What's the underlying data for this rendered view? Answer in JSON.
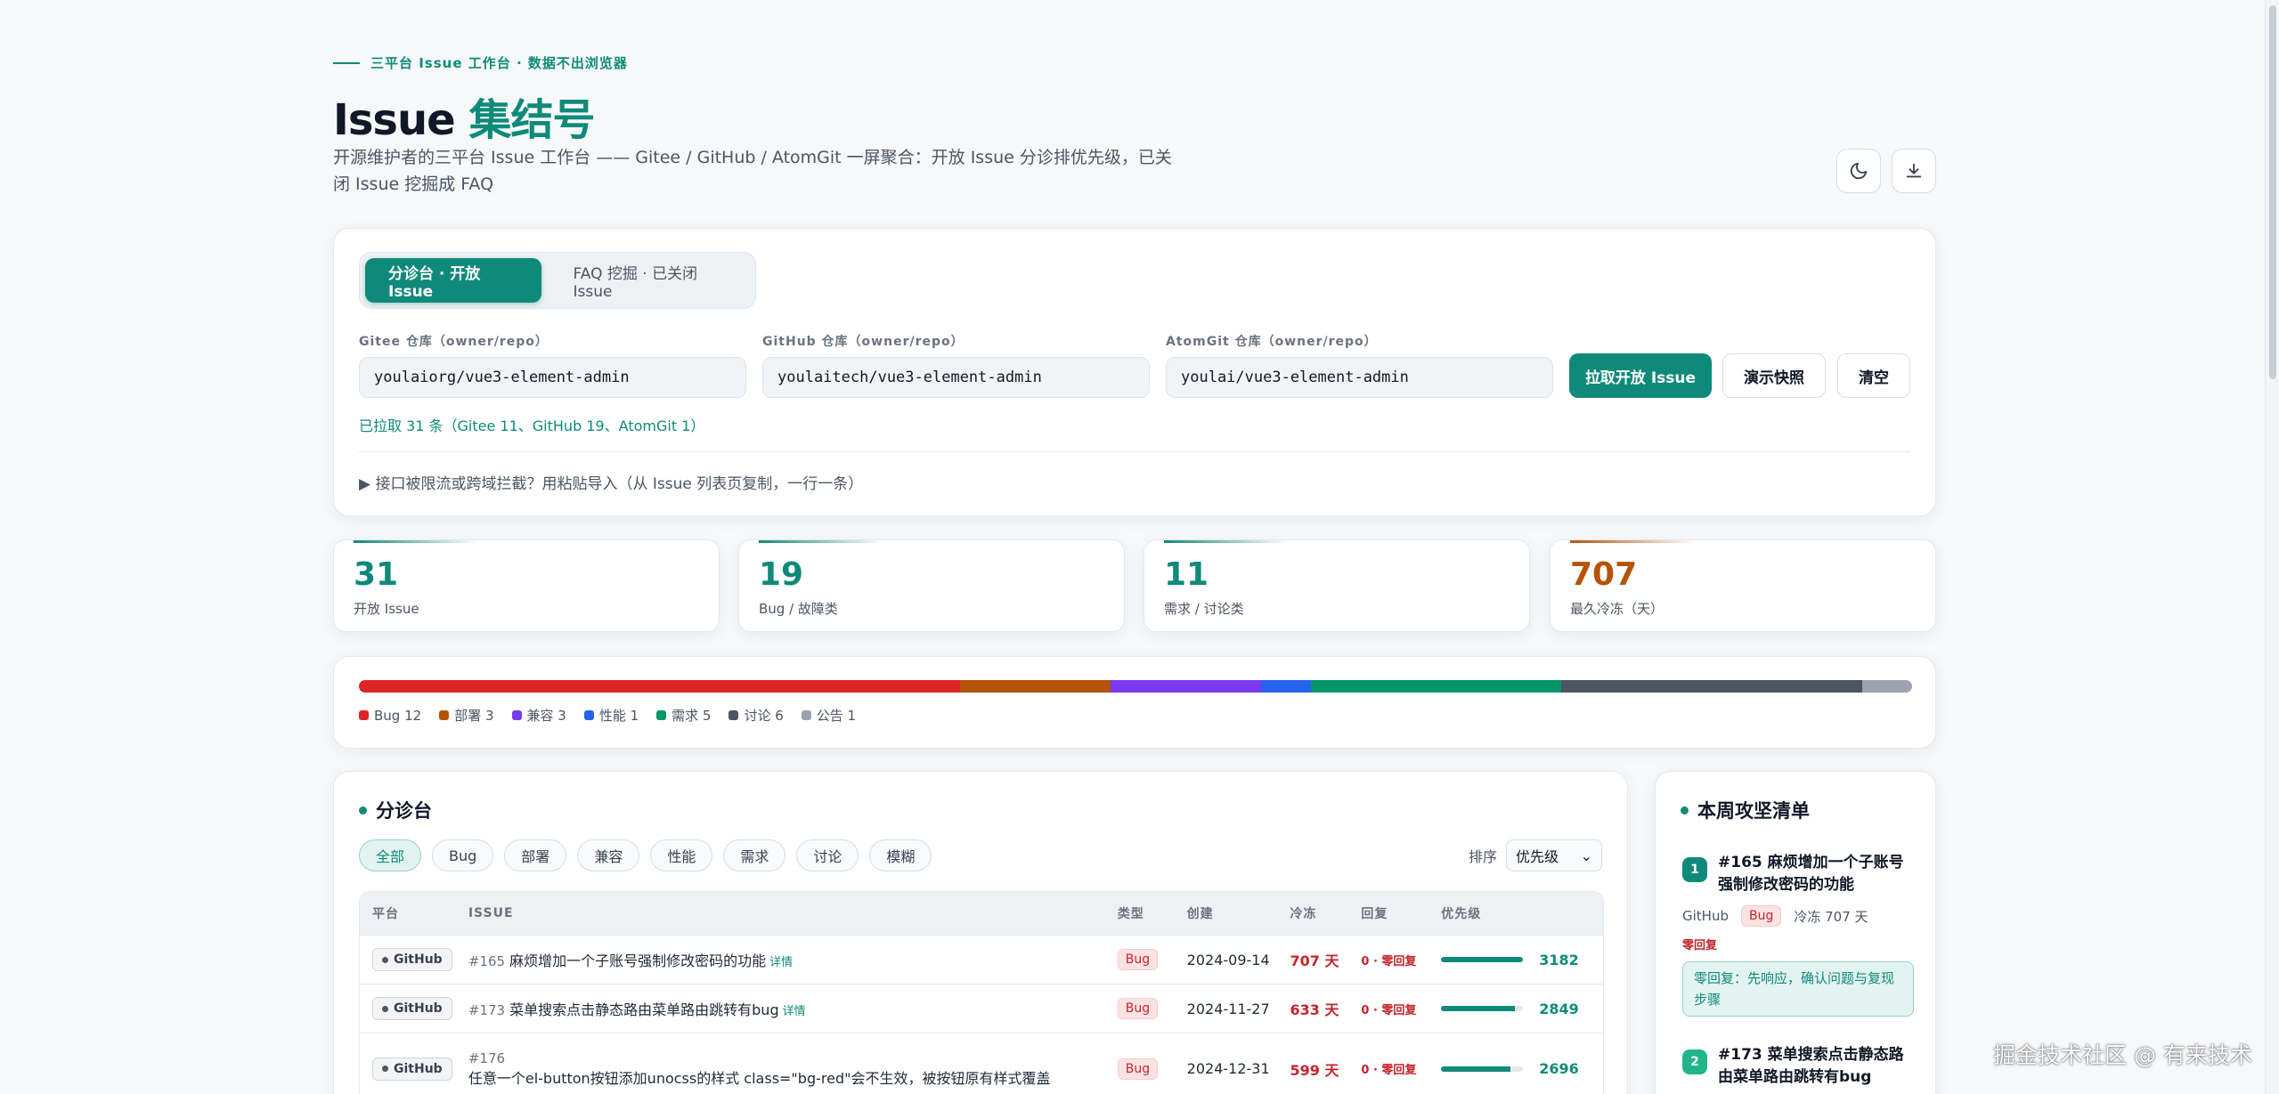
{
  "header": {
    "tagline": "三平台 Issue 工作台 · 数据不出浏览器",
    "title_main": "Issue ",
    "title_accent": "集结号",
    "subtitle": "开源维护者的三平台 Issue 工作台 —— Gitee / GitHub / AtomGit 一屏聚合：开放 Issue 分诊排优先级，已关闭 Issue 挖掘成 FAQ",
    "theme_icon": "moon-icon",
    "download_icon": "download-icon"
  },
  "panel": {
    "modes": [
      "分诊台 · 开放 Issue",
      "FAQ 挖掘 · 已关闭 Issue"
    ],
    "active_mode": 0,
    "fields": [
      {
        "label": "Gitee 仓库（owner/repo）",
        "value": "youlaiorg/vue3-element-admin"
      },
      {
        "label": "GitHub 仓库（owner/repo）",
        "value": "youlaitech/vue3-element-admin"
      },
      {
        "label": "AtomGit 仓库（owner/repo）",
        "value": "youlai/vue3-element-admin"
      }
    ],
    "buttons": {
      "fetch": "拉取开放 Issue",
      "demo": "演示快照",
      "clear": "清空"
    },
    "status": "已拉取 31 条（Gitee 11、GitHub 19、AtomGit 1）",
    "paste_toggle": "▶ 接口被限流或跨域拦截？用粘贴导入（从 Issue 列表页复制，一行一条）"
  },
  "stats": [
    {
      "value": "31",
      "label": "开放 Issue",
      "color": "#0f8a7a"
    },
    {
      "value": "19",
      "label": "Bug / 故障类",
      "color": "#0f8a7a"
    },
    {
      "value": "11",
      "label": "需求 / 讨论类",
      "color": "#0f8a7a"
    },
    {
      "value": "707",
      "label": "最久冷冻（天）",
      "color": "#b45309"
    }
  ],
  "distribution": [
    {
      "label": "Bug 12",
      "count": 12,
      "color": "#dc2626"
    },
    {
      "label": "部署 3",
      "count": 3,
      "color": "#b45309"
    },
    {
      "label": "兼容 3",
      "count": 3,
      "color": "#7c3aed"
    },
    {
      "label": "性能 1",
      "count": 1,
      "color": "#2563eb"
    },
    {
      "label": "需求 5",
      "count": 5,
      "color": "#059669"
    },
    {
      "label": "讨论 6",
      "count": 6,
      "color": "#4b5563"
    },
    {
      "label": "公告 1",
      "count": 1,
      "color": "#9ca3af"
    }
  ],
  "triage": {
    "title": "分诊台",
    "filters": [
      "全部",
      "Bug",
      "部署",
      "兼容",
      "性能",
      "需求",
      "讨论",
      "模糊"
    ],
    "active_filter": 0,
    "sort_label": "排序",
    "sort_value": "优先级",
    "columns": [
      "平台",
      "ISSUE",
      "类型",
      "创建",
      "冷冻",
      "回复",
      "优先级"
    ],
    "rows": [
      {
        "platform": "GitHub",
        "num": "#165",
        "title": "麻烦增加一个子账号强制修改密码的功能",
        "detail": "详情",
        "type": "Bug",
        "created": "2024-09-14",
        "frozen": "707 天",
        "reply": "0 · 零回复",
        "priority": 3182,
        "priority_pct": 1.0
      },
      {
        "platform": "GitHub",
        "num": "#173",
        "title": "菜单搜索点击静态路由菜单路由跳转有bug",
        "detail": "详情",
        "type": "Bug",
        "created": "2024-11-27",
        "frozen": "633 天",
        "reply": "0 · 零回复",
        "priority": 2849,
        "priority_pct": 0.9
      },
      {
        "platform": "GitHub",
        "num": "#176",
        "title": "任意一个el-button按钮添加unocss的样式 class=\"bg-red\"会不生效，被按钮原有样式覆盖",
        "detail": "",
        "type": "Bug",
        "created": "2024-12-31",
        "frozen": "599 天",
        "reply": "0 · 零回复",
        "priority": 2696,
        "priority_pct": 0.85
      }
    ]
  },
  "side": {
    "title": "本周攻坚清单",
    "items": [
      {
        "rank": "1",
        "title": "#165 麻烦增加一个子账号强制修改密码的功能",
        "platform": "GitHub",
        "type": "Bug",
        "frozen": "冷冻 707 天",
        "zero": "零回复",
        "hint": "零回复：先响应，确认问题与复现步骤"
      },
      {
        "rank": "2",
        "title": "#173 菜单搜索点击静态路由菜单路由跳转有bug"
      }
    ]
  },
  "watermark": "掘金技术社区 @ 有来技术"
}
